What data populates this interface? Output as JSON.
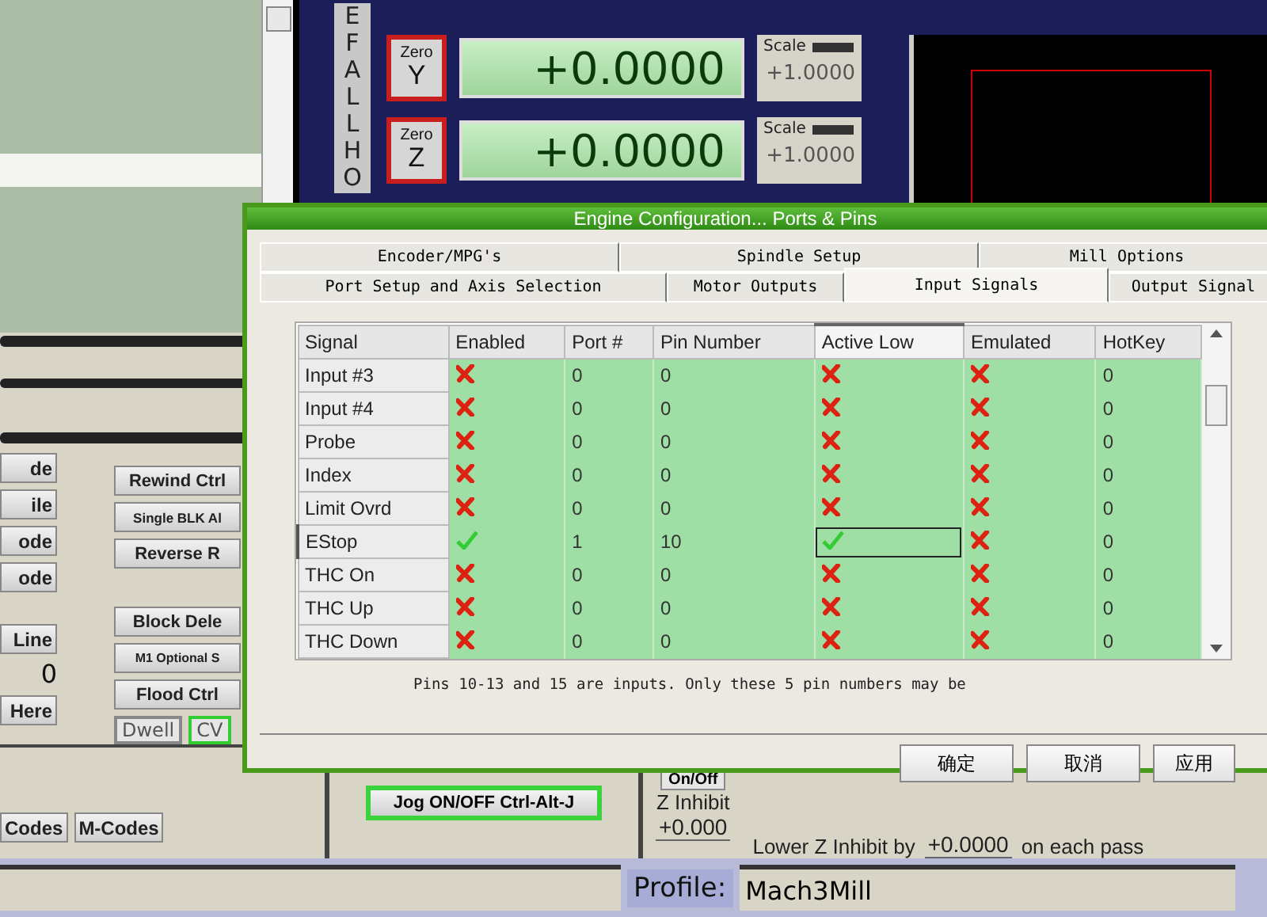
{
  "main_screen": {
    "home_letters": "EFALLHO",
    "axes": [
      {
        "zero_label": "Zero",
        "axis": "Y",
        "value": "+0.0000",
        "scale_label": "Scale",
        "scale": "+1.0000"
      },
      {
        "zero_label": "Zero",
        "axis": "Z",
        "value": "+0.0000",
        "scale_label": "Scale",
        "scale": "+1.0000"
      }
    ],
    "left_buttons": [
      "de",
      "ile",
      "ode",
      "ode"
    ],
    "line_button": "Line",
    "line_value": "0",
    "here_button": "Here",
    "center_buttons_top": [
      "Rewind Ctrl",
      "Single BLK Al",
      "Reverse R"
    ],
    "center_buttons_bottom": [
      "Block Dele",
      "M1 Optional S",
      "Flood Ctrl"
    ],
    "dwell": "Dwell",
    "cv": "CV",
    "code_buttons": [
      "Codes",
      "M-Codes"
    ],
    "jog_button": "Jog ON/OFF Ctrl-Alt-J",
    "on_off": "On/Off",
    "z_inhibit_label": "Z Inhibit",
    "z_inhibit_value": "+0.000",
    "lower_label": "Lower Z Inhibit by",
    "lower_value": "+0.0000",
    "lower_suffix": "on each pass",
    "profile_label": "Profile:",
    "profile": "Mach3Mill"
  },
  "dialog": {
    "title": "Engine Configuration... Ports & Pins",
    "tab_rows": [
      [
        {
          "label": "Encoder/MPG's",
          "selected": false
        },
        {
          "label": "Spindle Setup",
          "selected": false
        },
        {
          "label": "Mill Options",
          "selected": false
        }
      ],
      [
        {
          "label": "Port Setup and Axis Selection",
          "selected": false
        },
        {
          "label": "Motor Outputs",
          "selected": false
        },
        {
          "label": "Input Signals",
          "selected": true
        },
        {
          "label": "Output Signal",
          "selected": false
        }
      ]
    ],
    "columns": [
      {
        "label": "Signal",
        "selected": false
      },
      {
        "label": "Enabled",
        "selected": false
      },
      {
        "label": "Port #",
        "selected": false
      },
      {
        "label": "Pin Number",
        "selected": false
      },
      {
        "label": "Active Low",
        "selected": true
      },
      {
        "label": "Emulated",
        "selected": false
      },
      {
        "label": "HotKey",
        "selected": false
      }
    ],
    "rows": [
      {
        "signal": "Input #3",
        "enabled": false,
        "port": "0",
        "pin": "0",
        "active_low": false,
        "emulated": false,
        "hotkey": "0",
        "selected": false
      },
      {
        "signal": "Input #4",
        "enabled": false,
        "port": "0",
        "pin": "0",
        "active_low": false,
        "emulated": false,
        "hotkey": "0",
        "selected": false
      },
      {
        "signal": "Probe",
        "enabled": false,
        "port": "0",
        "pin": "0",
        "active_low": false,
        "emulated": false,
        "hotkey": "0",
        "selected": false
      },
      {
        "signal": "Index",
        "enabled": false,
        "port": "0",
        "pin": "0",
        "active_low": false,
        "emulated": false,
        "hotkey": "0",
        "selected": false
      },
      {
        "signal": "Limit Ovrd",
        "enabled": false,
        "port": "0",
        "pin": "0",
        "active_low": false,
        "emulated": false,
        "hotkey": "0",
        "selected": false
      },
      {
        "signal": "EStop",
        "enabled": true,
        "port": "1",
        "pin": "10",
        "active_low": true,
        "emulated": false,
        "hotkey": "0",
        "selected": true
      },
      {
        "signal": "THC On",
        "enabled": false,
        "port": "0",
        "pin": "0",
        "active_low": false,
        "emulated": false,
        "hotkey": "0",
        "selected": false
      },
      {
        "signal": "THC Up",
        "enabled": false,
        "port": "0",
        "pin": "0",
        "active_low": false,
        "emulated": false,
        "hotkey": "0",
        "selected": false
      },
      {
        "signal": "THC Down",
        "enabled": false,
        "port": "0",
        "pin": "0",
        "active_low": false,
        "emulated": false,
        "hotkey": "0",
        "selected": false
      }
    ],
    "note": "Pins 10-13 and 15 are inputs. Only these 5 pin numbers may be",
    "buttons": [
      "确定",
      "取消",
      "应用"
    ]
  }
}
